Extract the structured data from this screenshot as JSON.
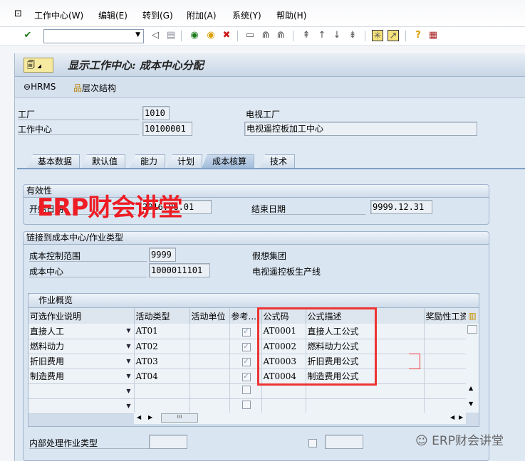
{
  "menu": [
    "工作中心(W)",
    "编辑(E)",
    "转到(G)",
    "附加(A)",
    "系统(Y)",
    "帮助(H)"
  ],
  "command_field": {
    "value": ""
  },
  "title": "显示工作中心: 成本中心分配",
  "app_toolbar": {
    "hrms": "HRMS",
    "hierarchy": "层次结构"
  },
  "header": {
    "plant_label": "工厂",
    "plant": "1010",
    "plant_desc": "电视工厂",
    "wc_label": "工作中心",
    "wc": "10100001",
    "wc_desc": "电视遥控板加工中心"
  },
  "tabs": [
    "基本数据",
    "默认值",
    "能力",
    "计划",
    "成本核算",
    "技术"
  ],
  "validity": {
    "title": "有效性",
    "start_label": "开始日期",
    "start": "2016.06.01",
    "end_label": "结束日期",
    "end": "9999.12.31"
  },
  "link": {
    "title": "链接到成本中心/作业类型",
    "ca_label": "成本控制范围",
    "ca": "9999",
    "ca_desc": "假想集团",
    "cc_label": "成本中心",
    "cc": "1000011101",
    "cc_desc": "电视遥控板生产线"
  },
  "activities": {
    "title": "作业概览",
    "columns": [
      "可选作业说明",
      "活动类型",
      "活动单位",
      "参考...",
      "公式码",
      "公式描述",
      "奖励性工资"
    ],
    "rows": [
      {
        "desc": "直接人工",
        "type": "AT01",
        "unit": "",
        "ref": true,
        "code": "AT0001",
        "fdesc": "直接人工公式"
      },
      {
        "desc": "燃料动力",
        "type": "AT02",
        "unit": "",
        "ref": true,
        "code": "AT0002",
        "fdesc": "燃料动力公式"
      },
      {
        "desc": "折旧费用",
        "type": "AT03",
        "unit": "",
        "ref": true,
        "code": "AT0003",
        "fdesc": "折旧费用公式"
      },
      {
        "desc": "制造费用",
        "type": "AT04",
        "unit": "",
        "ref": true,
        "code": "AT0004",
        "fdesc": "制造费用公式"
      },
      {
        "desc": "",
        "type": "",
        "unit": "",
        "ref": false,
        "code": "",
        "fdesc": ""
      },
      {
        "desc": "",
        "type": "",
        "unit": "",
        "ref": false,
        "code": "",
        "fdesc": ""
      }
    ]
  },
  "internal": {
    "label": "内部处理作业类型",
    "value": ""
  },
  "watermark": "ERP财会讲堂",
  "footer_watermark": "ERP财会讲堂",
  "colors": {
    "highlight": "#ee3333",
    "background": "#dfe9f4"
  }
}
